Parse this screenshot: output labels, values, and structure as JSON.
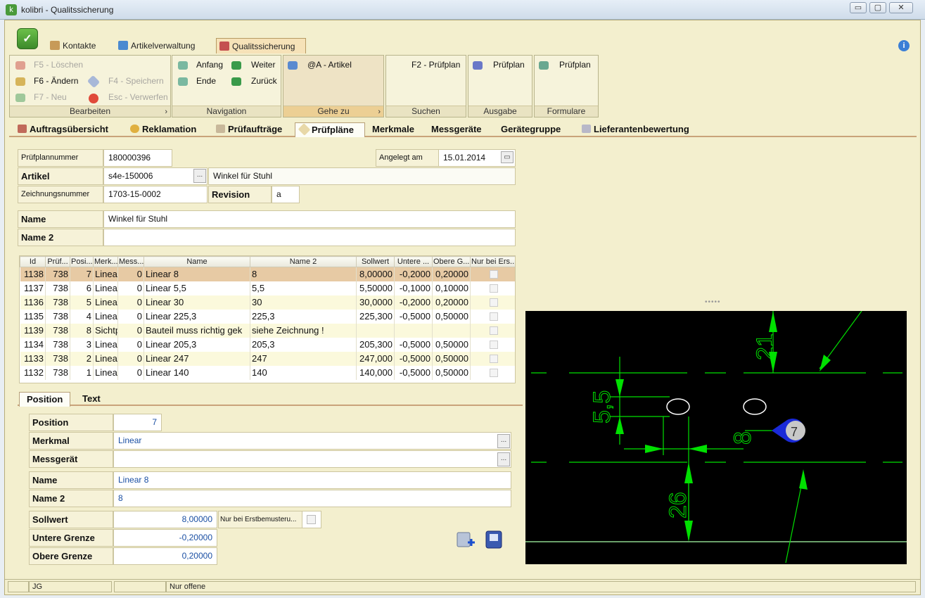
{
  "window": {
    "title": "kolibri - Qualitssicherung",
    "min": "▭",
    "max": "▢",
    "close": "✕"
  },
  "ribbon": {
    "app_icon": "kolibri-logo-icon",
    "tabs": [
      {
        "label": "Kontakte"
      },
      {
        "label": "Artikelverwaltung"
      },
      {
        "label": "Qualitssicherung"
      }
    ],
    "groups": {
      "bearbeiten": {
        "label": "Bearbeiten",
        "delete": "F5 - Löschen",
        "edit": "F6 - Ändern",
        "new": "F7 - Neu",
        "save": "F4 - Speichern",
        "discard": "Esc - Verwerfen"
      },
      "navigation": {
        "label": "Navigation",
        "first": "Anfang",
        "next": "Weiter",
        "last": "Ende",
        "prev": "Zurück"
      },
      "gehezu": {
        "label": "Gehe zu",
        "article": "@A - Artikel"
      },
      "suchen": {
        "label": "Suchen",
        "plan": "F2 - Prüfplan"
      },
      "ausgabe": {
        "label": "Ausgabe",
        "plan": "Prüfplan"
      },
      "formulare": {
        "label": "Formulare",
        "plan": "Prüfplan"
      }
    }
  },
  "maintabs": [
    {
      "label": "Auftragsübersicht"
    },
    {
      "label": "Reklamation"
    },
    {
      "label": "Prüfaufträge"
    },
    {
      "label": "Prüfpläne"
    },
    {
      "label": "Merkmale"
    },
    {
      "label": "Messgeräte"
    },
    {
      "label": "Gerätegruppe"
    },
    {
      "label": "Lieferantenbewertung"
    }
  ],
  "header": {
    "pruefplannummer_label": "Prüfplannummer",
    "pruefplannummer": "180000396",
    "angelegt_label": "Angelegt am",
    "angelegt": "15.01.2014",
    "artikel_label": "Artikel",
    "artikel": "s4e-150006",
    "artikel_name": "Winkel für Stuhl",
    "zeichnung_label": "Zeichnungsnummer",
    "zeichnung": "1703-15-0002",
    "revision_label": "Revision",
    "revision": "a",
    "name_label": "Name",
    "name": "Winkel für Stuhl",
    "name2_label": "Name 2",
    "name2": "",
    "ellipsis": "..."
  },
  "grid": {
    "columns": [
      "Id",
      "Prüf...",
      "Posi...",
      "Merk...",
      "Mess...",
      "Name",
      "Name 2",
      "Sollwert",
      "Untere ...",
      "Obere G...",
      "Nur bei Ers..."
    ],
    "rows": [
      [
        "1138",
        "738",
        "7",
        "Linea",
        "0",
        "Linear 8",
        "8",
        "8,00000",
        "-0,2000",
        "0,20000"
      ],
      [
        "1137",
        "738",
        "6",
        "Linea",
        "0",
        "Linear 5,5",
        "5,5",
        "5,50000",
        "-0,1000",
        "0,10000"
      ],
      [
        "1136",
        "738",
        "5",
        "Linea",
        "0",
        "Linear 30",
        "30",
        "30,0000",
        "-0,2000",
        "0,20000"
      ],
      [
        "1135",
        "738",
        "4",
        "Linea",
        "0",
        "Linear 225,3",
        "225,3",
        "225,300",
        "-0,5000",
        "0,50000"
      ],
      [
        "1139",
        "738",
        "8",
        "Sichtp",
        "0",
        "Bauteil muss richtig gek",
        "siehe Zeichnung !",
        "",
        "",
        ""
      ],
      [
        "1134",
        "738",
        "3",
        "Linea",
        "0",
        "Linear 205,3",
        "205,3",
        "205,300",
        "-0,5000",
        "0,50000"
      ],
      [
        "1133",
        "738",
        "2",
        "Linea",
        "0",
        "Linear 247",
        "247",
        "247,000",
        "-0,5000",
        "0,50000"
      ],
      [
        "1132",
        "738",
        "1",
        "Linea",
        "0",
        "Linear 140",
        "140",
        "140,000",
        "-0,5000",
        "0,50000"
      ]
    ]
  },
  "subtabs": [
    {
      "label": "Position"
    },
    {
      "label": "Text"
    }
  ],
  "detail": {
    "position_label": "Position",
    "position": "7",
    "merkmal_label": "Merkmal",
    "merkmal": "Linear",
    "messgeraet_label": "Messgerät",
    "messgeraet": "",
    "name_label": "Name",
    "name": "Linear 8",
    "name2_label": "Name 2",
    "name2": "8",
    "soll_label": "Sollwert",
    "soll": "8,00000",
    "erst_label": "Nur bei Erstbemusteru...",
    "unten_label": "Untere Grenze",
    "unten": "-0,20000",
    "oben_label": "Obere Grenze",
    "oben": "0,20000"
  },
  "drawing": {
    "dims": [
      "21",
      "5,5",
      "8",
      "26",
      "7"
    ],
    "line_color": "#00e000",
    "bg": "#000000"
  },
  "status": {
    "cell1": "",
    "user": "JG",
    "cell3": "",
    "filter": "Nur offene"
  },
  "colors": {
    "frame": "#f3efce",
    "selection": "#e7caa4",
    "accent": "#c9a37a"
  }
}
